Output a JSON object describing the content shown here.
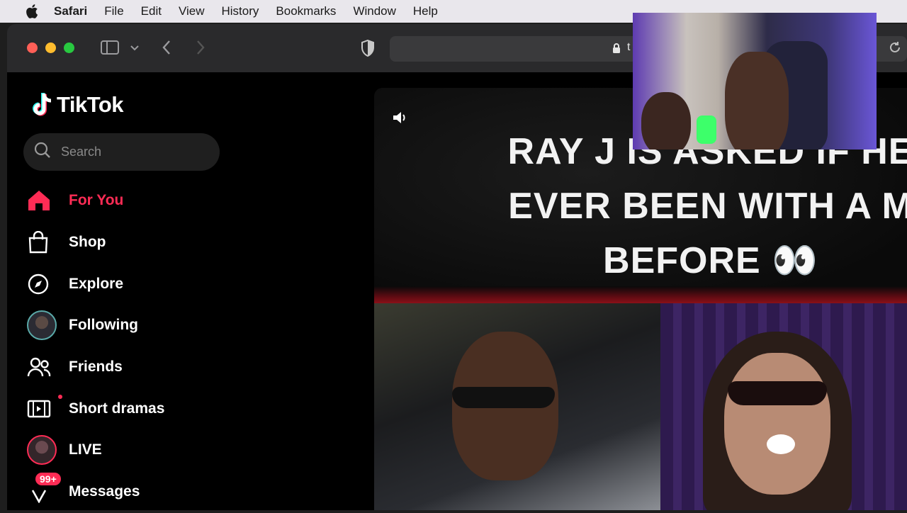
{
  "menubar": {
    "app": "Safari",
    "items": [
      "File",
      "Edit",
      "View",
      "History",
      "Bookmarks",
      "Window",
      "Help"
    ]
  },
  "toolbar": {
    "url_visible": "t"
  },
  "sidebar": {
    "logo": "TikTok",
    "search_placeholder": "Search",
    "nav": [
      {
        "label": "For You",
        "icon": "home-icon"
      },
      {
        "label": "Shop",
        "icon": "shopping-bag-icon"
      },
      {
        "label": "Explore",
        "icon": "compass-icon"
      },
      {
        "label": "Following",
        "icon": "avatar"
      },
      {
        "label": "Friends",
        "icon": "friends-icon"
      },
      {
        "label": "Short dramas",
        "icon": "film-icon"
      },
      {
        "label": "LIVE",
        "icon": "live-avatar"
      },
      {
        "label": "Messages",
        "icon": "messages-icon",
        "badge": "99+"
      }
    ]
  },
  "video": {
    "headline_lines": [
      "RAY J IS ASKED IF HE",
      "EVER BEEN WITH A M",
      "BEFORE 👀"
    ]
  },
  "colors": {
    "accent": "#fe2c55",
    "background": "#000000"
  }
}
